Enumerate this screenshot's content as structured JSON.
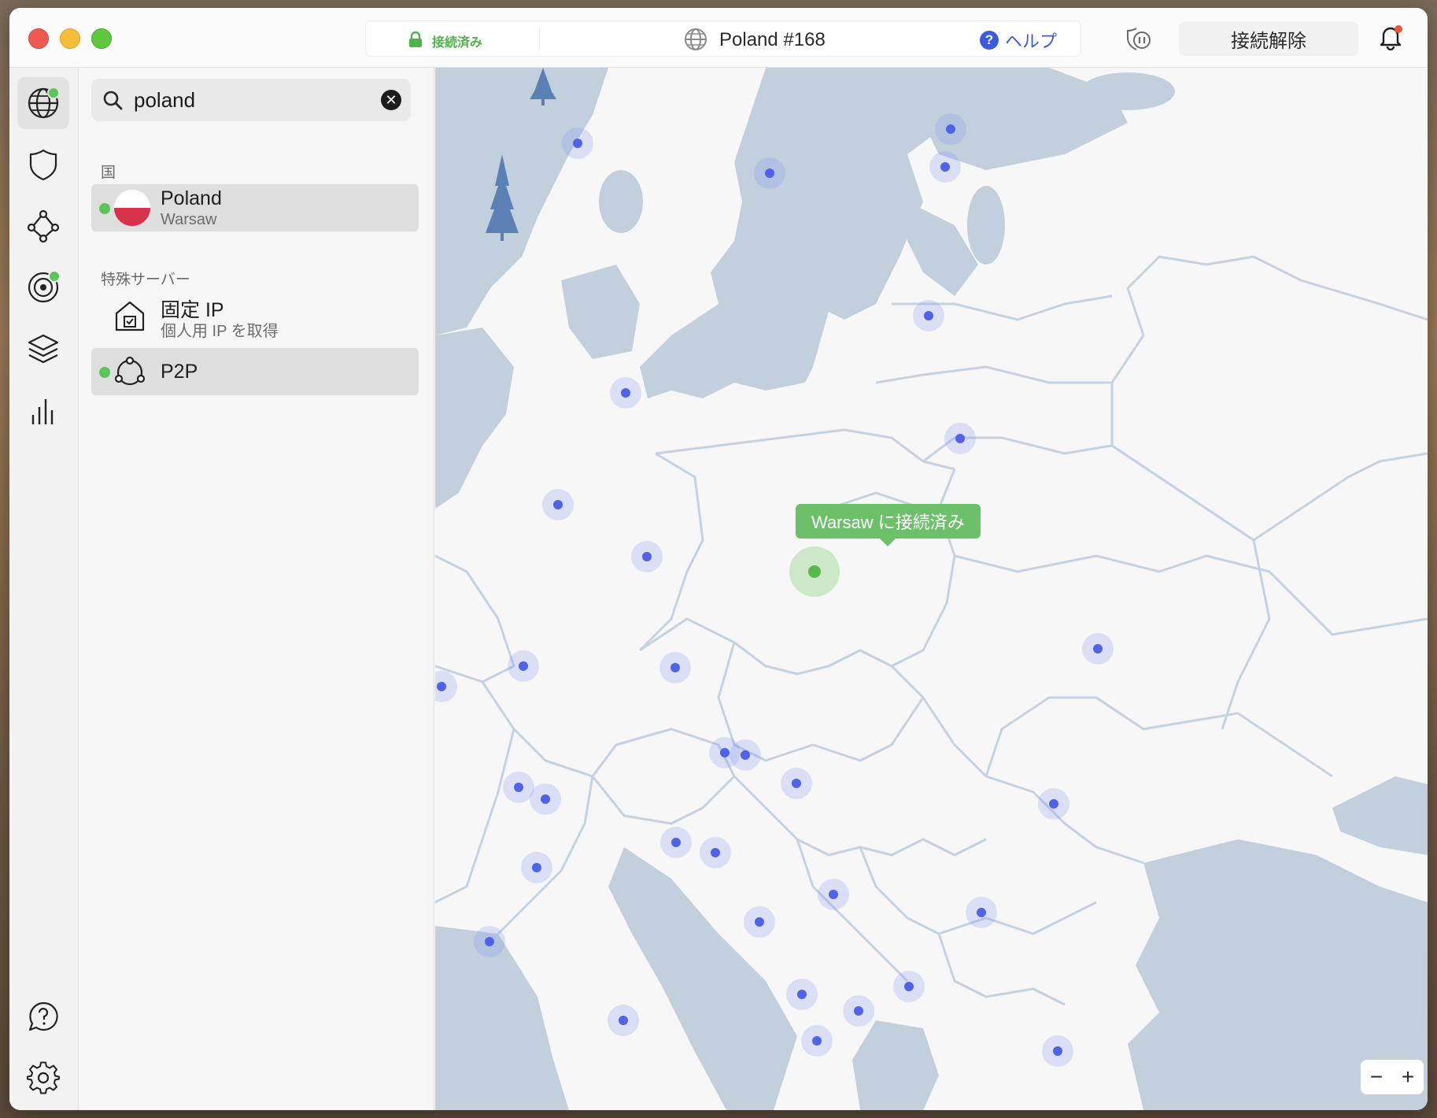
{
  "titlebar": {
    "status": "接続済み",
    "server": "Poland #168",
    "help_label": "ヘルプ",
    "help_symbol": "?",
    "disconnect_label": "接続解除"
  },
  "search": {
    "value": "poland",
    "clear_symbol": "✕"
  },
  "sections": {
    "countries": "国",
    "special_servers": "特殊サーバー"
  },
  "results": {
    "country": {
      "name": "Poland",
      "city": "Warsaw"
    },
    "dedicated_ip": {
      "title": "固定 IP",
      "subtitle": "個人用 IP を取得"
    },
    "p2p": {
      "title": "P2P"
    }
  },
  "map": {
    "connected_label": "Warsaw に接続済み",
    "zoom_out": "−",
    "zoom_in": "+"
  },
  "colors": {
    "connected_green": "#5bc55a",
    "accent_blue": "#3a5be0",
    "server_dot": "#4f63e8",
    "water": "#c2d0de",
    "land": "#f7f7f8"
  }
}
